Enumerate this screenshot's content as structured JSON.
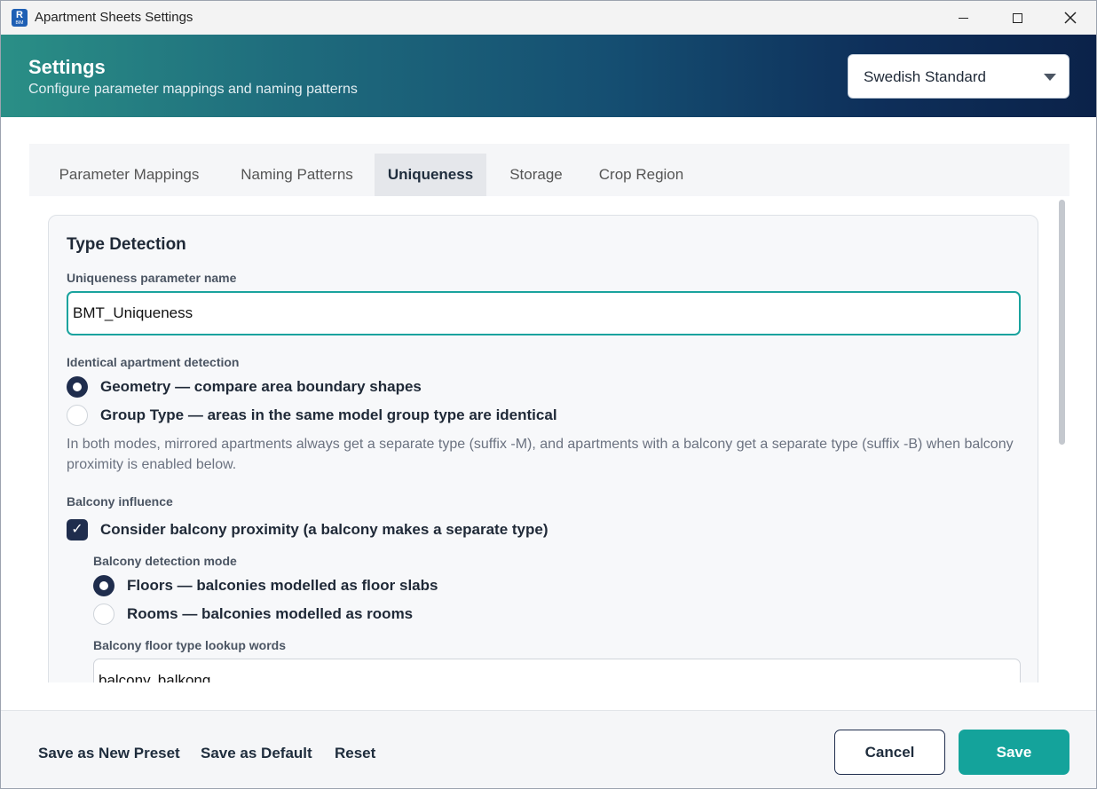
{
  "window": {
    "title": "Apartment Sheets Settings",
    "app_icon_letter": "R",
    "app_icon_sub": "BIM"
  },
  "header": {
    "title": "Settings",
    "subtitle": "Configure parameter mappings and naming patterns",
    "preset_value": "Swedish Standard"
  },
  "tabs": [
    {
      "label": "Parameter Mappings",
      "active": false
    },
    {
      "label": "Naming Patterns",
      "active": false
    },
    {
      "label": "Uniqueness",
      "active": true
    },
    {
      "label": "Storage",
      "active": false
    },
    {
      "label": "Crop Region",
      "active": false
    }
  ],
  "type_detection": {
    "title": "Type Detection",
    "param_label": "Uniqueness parameter name",
    "param_value": "BMT_Uniqueness",
    "identical_label": "Identical apartment detection",
    "options": [
      {
        "label": "Geometry — compare area boundary shapes",
        "checked": true
      },
      {
        "label": "Group Type — areas in the same model group type are identical",
        "checked": false
      }
    ],
    "help": "In both modes, mirrored apartments always get a separate type (suffix -M), and apartments with a balcony get a separate type (suffix -B) when balcony proximity is enabled below.",
    "balcony_label": "Balcony influence",
    "balcony_checkbox": {
      "label": "Consider balcony proximity (a balcony makes a separate type)",
      "checked": true,
      "mark": "✓"
    },
    "mode_label": "Balcony detection mode",
    "mode_options": [
      {
        "label": "Floors — balconies modelled as floor slabs",
        "checked": true
      },
      {
        "label": "Rooms — balconies modelled as rooms",
        "checked": false
      }
    ],
    "lookup_label": "Balcony floor type lookup words",
    "lookup_value": "balcony, balkong"
  },
  "footer": {
    "save_new_preset": "Save as New Preset",
    "save_default": "Save as Default",
    "reset": "Reset",
    "cancel": "Cancel",
    "save": "Save"
  }
}
